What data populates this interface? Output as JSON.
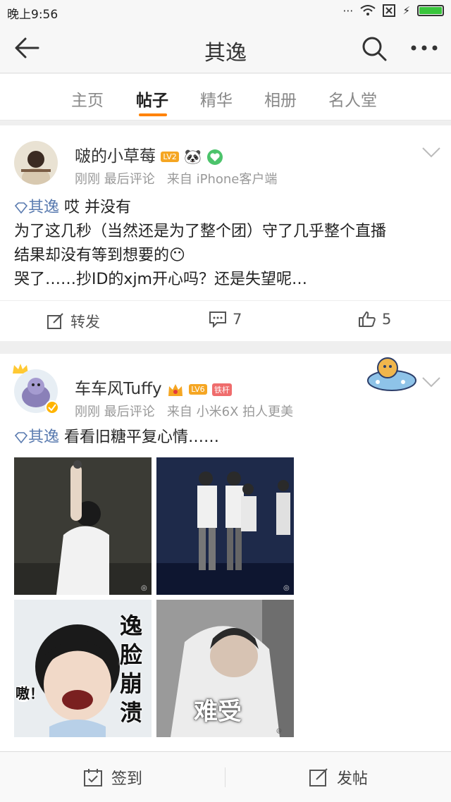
{
  "status_bar": {
    "time": "晚上9:56"
  },
  "header": {
    "title": "其逸"
  },
  "tabs": [
    {
      "label": "主页"
    },
    {
      "label": "帖子"
    },
    {
      "label": "精华"
    },
    {
      "label": "相册"
    },
    {
      "label": "名人堂"
    }
  ],
  "active_tab": "帖子",
  "posts": [
    {
      "username": "啵的小草莓",
      "level": "LV2",
      "time": "刚刚",
      "last_comment": "最后评论",
      "source": "来自 iPhone客户端",
      "topic": "其逸",
      "lines": [
        "哎 并没有",
        "为了这几秒（当然还是为了整个团）守了几乎整个直播",
        "结果却没有等到想要的😶",
        "哭了……抄ID的xjm开心吗？还是失望呢…"
      ],
      "repost_label": "转发",
      "comment_count": "7",
      "like_count": "5"
    },
    {
      "username": "车车风Tuffy",
      "level": "LV6",
      "tag": "铁杆",
      "time": "刚刚",
      "last_comment": "最后评论",
      "source": "来自 小米6X 拍人更美",
      "topic": "其逸",
      "text": "看看旧糖平复心情……",
      "image_captions": {
        "pic3_vertical": "逸脸崩溃",
        "pic3_side": "嗷！",
        "pic4": "难受"
      }
    }
  ],
  "bottom_bar": {
    "checkin_label": "签到",
    "post_label": "发帖"
  },
  "colors": {
    "accent": "#ff8200",
    "topic_link": "#5a7bb0",
    "level_badge": "#f5a623",
    "tag_badge": "#ef6c6c"
  }
}
